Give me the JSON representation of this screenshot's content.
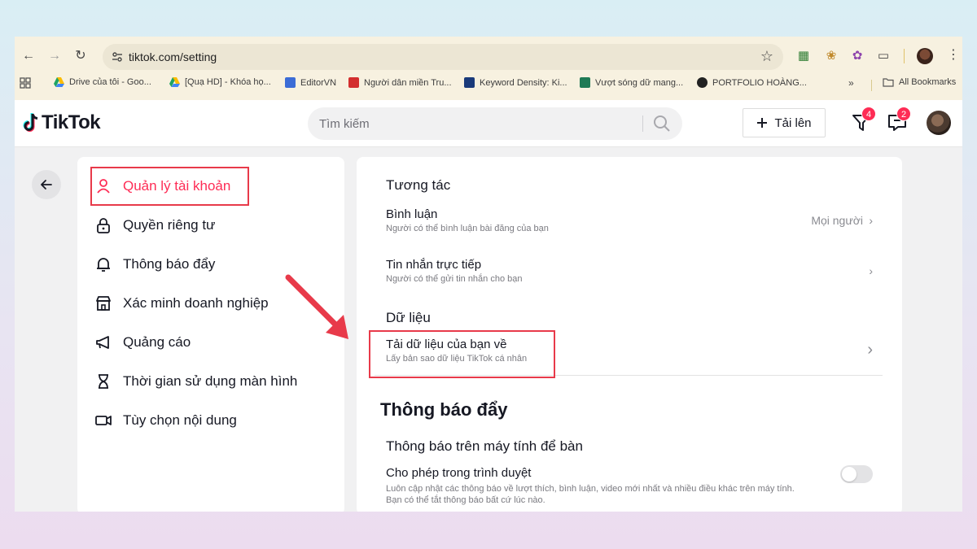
{
  "browser": {
    "url": "tiktok.com/setting",
    "bookmarks": [
      {
        "label": "Drive của tôi - Goo...",
        "color": "#1fa463"
      },
      {
        "label": "[Quạ HD] - Khóa họ...",
        "color": "#1fa463"
      },
      {
        "label": "EditorVN",
        "color": "#3b6cd6"
      },
      {
        "label": "Người dân miền Tru...",
        "color": "#d32f2f"
      },
      {
        "label": "Keyword Density: Ki...",
        "color": "#1a3a7a"
      },
      {
        "label": "Vượt sóng dữ mang...",
        "color": "#1f7a55"
      },
      {
        "label": "PORTFOLIO HOÀNG...",
        "color": "#222222"
      }
    ],
    "all_bookmarks": "All Bookmarks"
  },
  "header": {
    "logo_text": "TikTok",
    "search_placeholder": "Tìm kiếm",
    "upload_label": "Tải lên",
    "inbox_badge": "4",
    "messages_badge": "2"
  },
  "sidebar": {
    "items": [
      {
        "label": "Quản lý tài khoản",
        "icon": "person-icon",
        "active": true
      },
      {
        "label": "Quyền riêng tư",
        "icon": "lock-icon"
      },
      {
        "label": "Thông báo đẩy",
        "icon": "bell-icon"
      },
      {
        "label": "Xác minh doanh nghiệp",
        "icon": "store-icon"
      },
      {
        "label": "Quảng cáo",
        "icon": "megaphone-icon"
      },
      {
        "label": "Thời gian sử dụng màn hình",
        "icon": "hourglass-icon"
      },
      {
        "label": "Tùy chọn nội dung",
        "icon": "video-icon"
      }
    ]
  },
  "content": {
    "interaction_title": "Tương tác",
    "comments_title": "Bình luận",
    "comments_sub": "Người có thể bình luận bài đăng của bạn",
    "comments_value": "Mọi người",
    "dm_title": "Tin nhắn trực tiếp",
    "dm_sub": "Người có thể gửi tin nhắn cho bạn",
    "data_title": "Dữ liệu",
    "download_title": "Tải dữ liệu của bạn về",
    "download_sub": "Lấy bản sao dữ liệu TikTok cá nhân",
    "push_title": "Thông báo đẩy",
    "desktop_title": "Thông báo trên máy tính để bàn",
    "browser_allow_title": "Cho phép trong trình duyệt",
    "browser_allow_sub1": "Luôn cập nhật các thông báo về lượt thích, bình luận, video mới nhất và nhiều điều khác trên máy tính.",
    "browser_allow_sub2": "Bạn có thể tắt thông báo bất cứ lúc nào."
  },
  "colors": {
    "accent": "#fe2c55",
    "annotation": "#e83a4a"
  }
}
